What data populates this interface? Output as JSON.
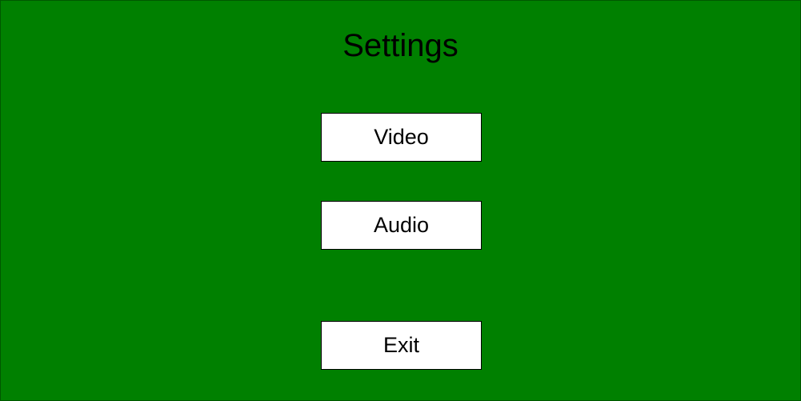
{
  "screen": {
    "title": "Settings",
    "background_color": "#008000"
  },
  "menu": {
    "video_label": "Video",
    "audio_label": "Audio",
    "exit_label": "Exit"
  }
}
